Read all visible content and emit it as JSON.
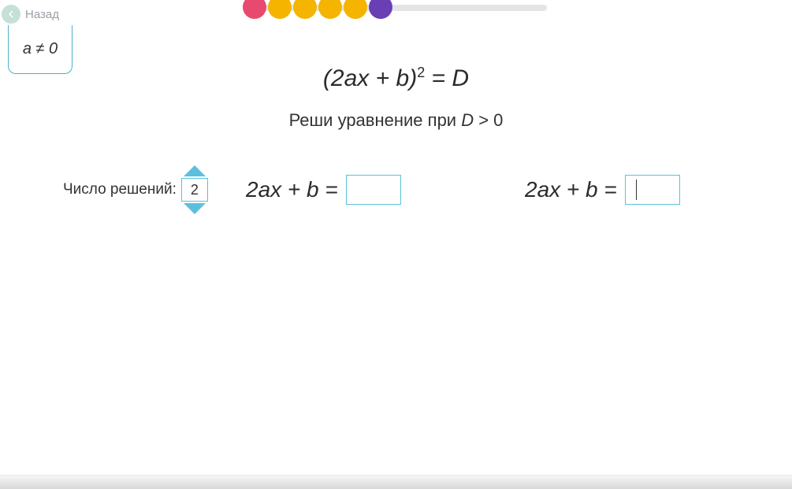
{
  "nav": {
    "back_label": "Назад"
  },
  "condition": {
    "text": "a ≠ 0"
  },
  "progress": {
    "dots": [
      {
        "color": "#e84a6f"
      },
      {
        "color": "#f4b400"
      },
      {
        "color": "#f4b400"
      },
      {
        "color": "#f4b400"
      },
      {
        "color": "#f4b400"
      },
      {
        "color": "#6a3fb5"
      }
    ]
  },
  "equation": {
    "lhs_open": "(",
    "term1": "2ax",
    "plus": " + ",
    "term2": "b",
    "lhs_close": ")",
    "exp": "2",
    "equals": " = ",
    "rhs": "D"
  },
  "prompt": {
    "prefix": "Реши уравнение при ",
    "var": "D",
    "cond": " > 0"
  },
  "solutions": {
    "label": "Число решений:",
    "value": "2"
  },
  "eq_line": {
    "text": "2ax + b ="
  },
  "answers": {
    "first": "",
    "second": ""
  }
}
